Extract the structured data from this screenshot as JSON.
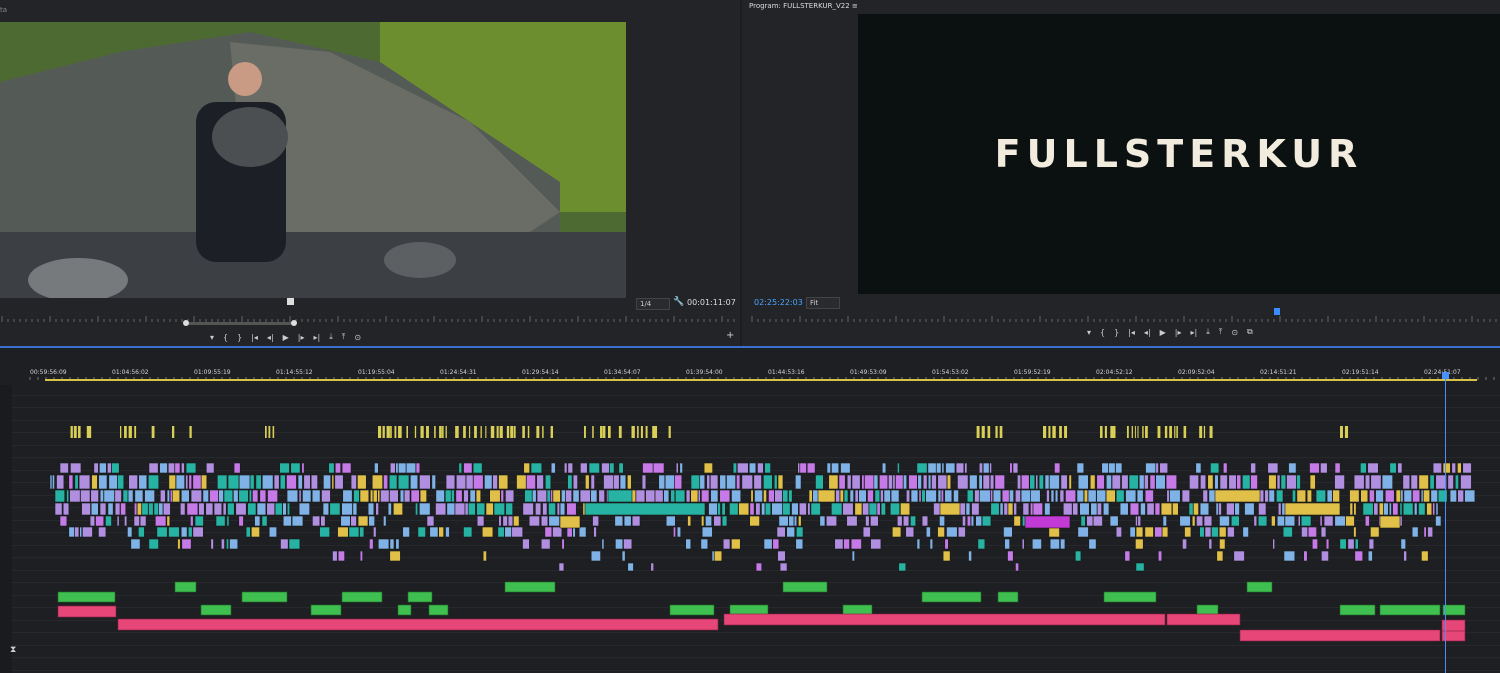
{
  "source_monitor": {
    "label": "ta",
    "zoom": "1/4",
    "timecode": "00:01:11:07",
    "icon": "wrench-icon",
    "transport": [
      "▾",
      "{",
      "}",
      "|◂",
      "◂|",
      "▶",
      "|▸",
      "▸|",
      "⤓",
      "⤒",
      "⊙"
    ],
    "add": "+"
  },
  "program_monitor": {
    "label": "Program: FULLSTERKUR_V22  ≡",
    "title_card": "FULLSTERKUR",
    "timecode": "02:25:22:03",
    "fit": "Fit",
    "transport": [
      "▾",
      "{",
      "}",
      "|◂",
      "◂|",
      "▶",
      "|▸",
      "▸|",
      "⤓",
      "⤒",
      "⊙",
      "⧉"
    ]
  },
  "timeline": {
    "ruler_labels": [
      "00:59:56:09",
      "01:04:56:02",
      "01:09:55:19",
      "01:14:55:12",
      "01:19:55:04",
      "01:24:54:31",
      "01:29:54:14",
      "01:34:54:07",
      "01:39:54:00",
      "01:44:53:16",
      "01:49:53:09",
      "01:54:53:02",
      "01:59:52:19",
      "02:04:52:12",
      "02:09:52:04",
      "02:14:51:21",
      "02:19:51:14",
      "02:24:51:07"
    ],
    "colors": {
      "yellow": "#d9cf55",
      "lavender": "#b08ee0",
      "violet": "#c67ae8",
      "blue": "#7fb2e6",
      "teal": "#27b3a4",
      "gold": "#e0c048",
      "magenta": "#c23bd6",
      "green": "#3fbf4f",
      "pink": "#e64778",
      "playhead": "#4a8fff"
    },
    "collapse_icon": "collapse-arrows-icon"
  }
}
